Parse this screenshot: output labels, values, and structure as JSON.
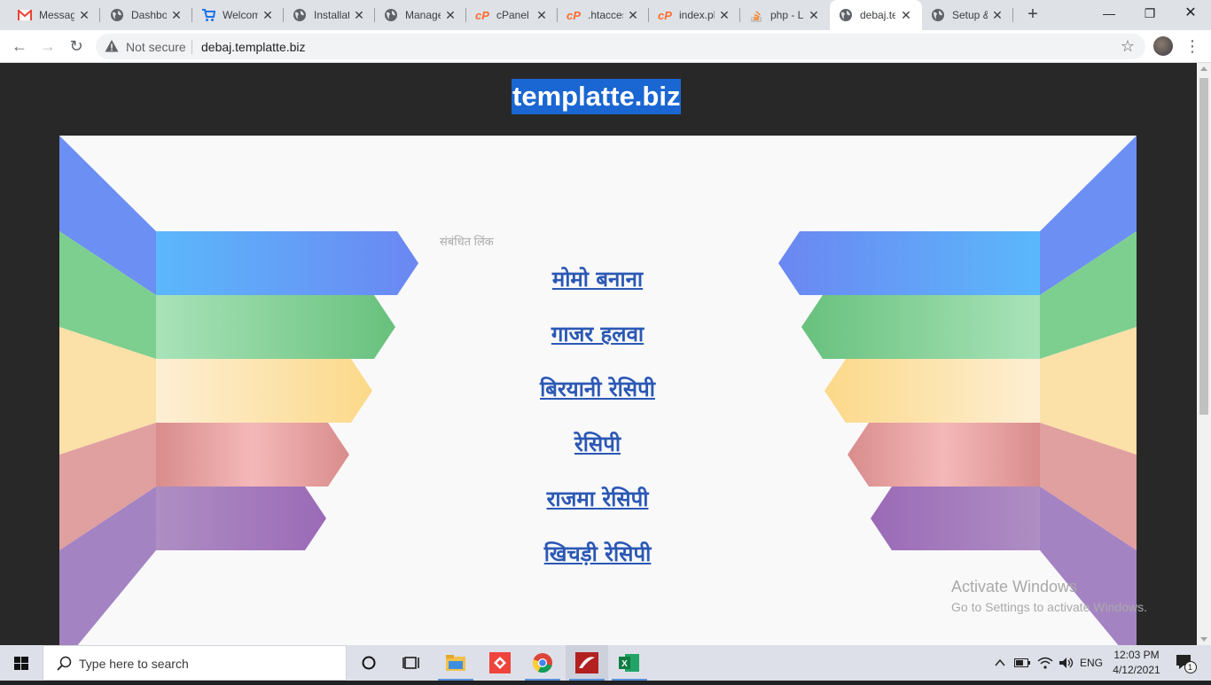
{
  "tabs": [
    {
      "title": "Messages",
      "icon": "gmail-icon"
    },
    {
      "title": "Dashboard",
      "icon": "globe-icon"
    },
    {
      "title": "Welcome",
      "icon": "cart-icon"
    },
    {
      "title": "Installation",
      "icon": "globe-icon"
    },
    {
      "title": "Manage",
      "icon": "globe-icon"
    },
    {
      "title": "cPanel",
      "icon": "cpanel-icon"
    },
    {
      "title": ".htaccess",
      "icon": "cpanel-icon"
    },
    {
      "title": "index.php",
      "icon": "cpanel-icon"
    },
    {
      "title": "php - L",
      "icon": "stackoverflow-icon"
    },
    {
      "title": "debaj.templatte.biz",
      "icon": "globe-icon"
    },
    {
      "title": "Setup &",
      "icon": "globe-icon"
    }
  ],
  "active_tab_index": 9,
  "toolbar": {
    "security_label": "Not secure",
    "url": "debaj.templatte.biz"
  },
  "page": {
    "domain_title": "templatte.biz",
    "related_label": "संबंधित लिंक",
    "links": [
      "मोमो बनाना",
      "गाजर हलवा",
      "बिरयानी रेसिपी",
      "रेसिपी",
      "राजमा रेसिपी",
      "खिचड़ी रेसिपी"
    ],
    "watermark_title": "Activate Windows",
    "watermark_sub": "Go to Settings to activate Windows."
  },
  "taskbar": {
    "search_placeholder": "Type here to search",
    "language": "ENG",
    "time": "12:03 PM",
    "date": "4/12/2021",
    "notification_count": "1"
  },
  "colors": {
    "link": "#2b58b5",
    "domain_highlight": "#1a66d2",
    "page_bg": "#282828"
  }
}
